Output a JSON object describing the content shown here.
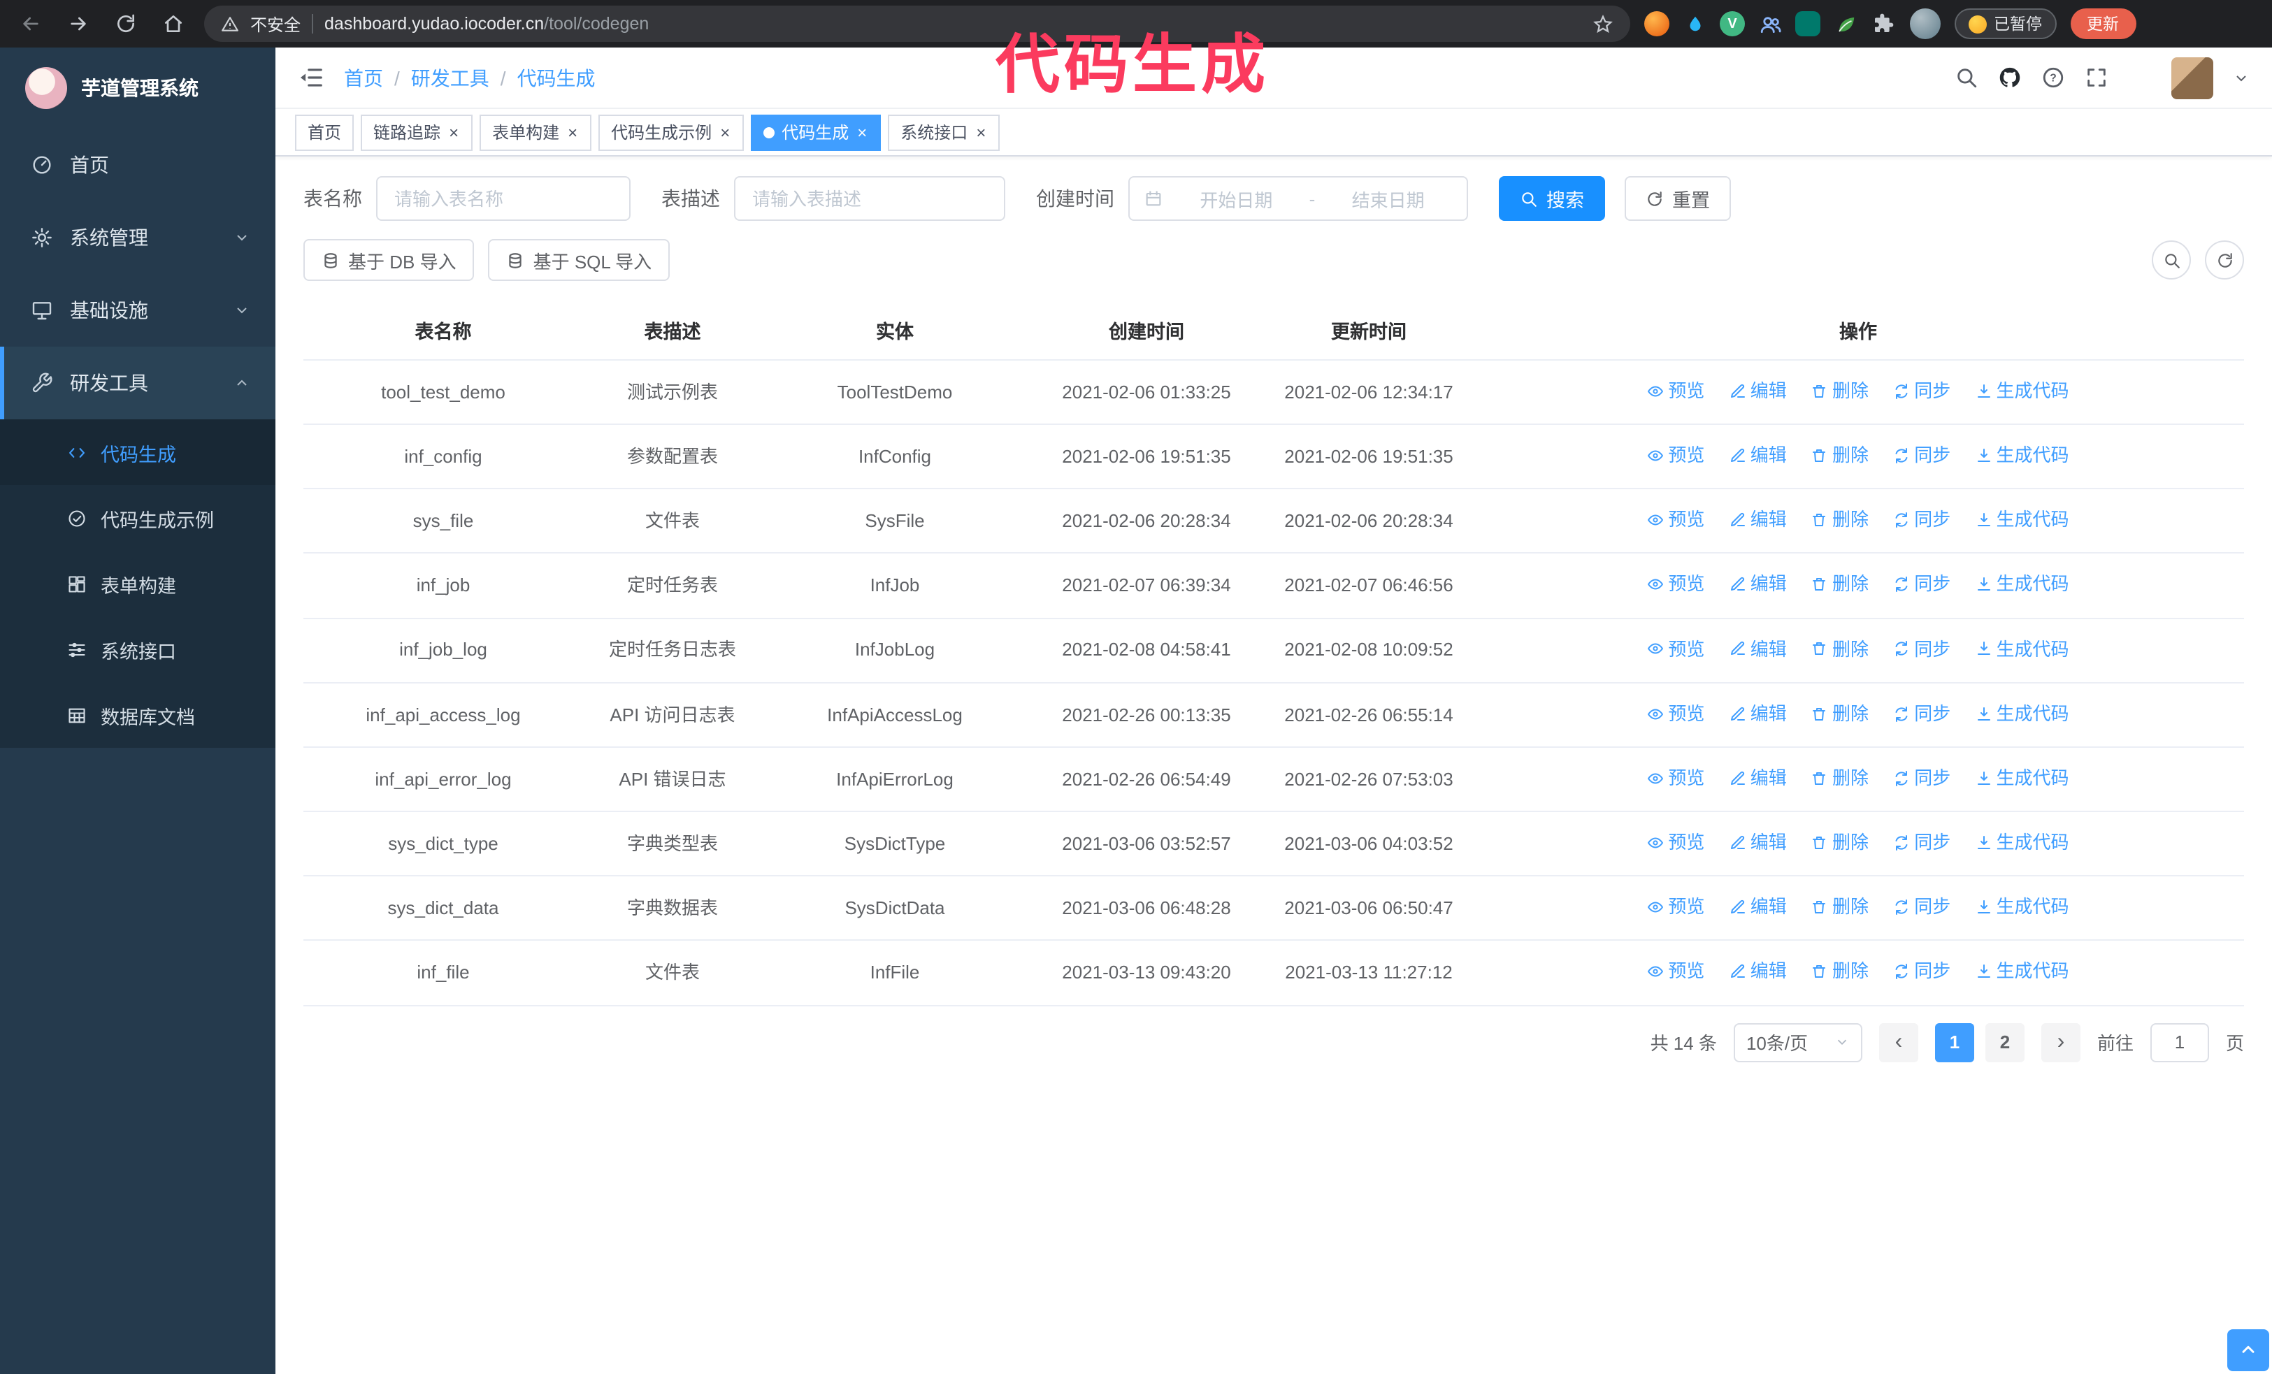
{
  "colors": {
    "accent": "#409EFF",
    "search_button": "#1890ff",
    "annotation": "#fb3b5e",
    "sidebar_bg": "#253a4d"
  },
  "annotation": {
    "text": "代码生成"
  },
  "browser": {
    "security": "不安全",
    "url": {
      "domain": "dashboard.yudao.iocoder.cn",
      "path": "/tool/codegen"
    },
    "paused_badge": "已暂停",
    "update_button": "更新"
  },
  "sidebar": {
    "title": "芋道管理系统",
    "items": [
      {
        "label": "首页",
        "icon": "gauge"
      },
      {
        "label": "系统管理",
        "icon": "gear",
        "chevron": "down"
      },
      {
        "label": "基础设施",
        "icon": "monitor",
        "chevron": "down"
      },
      {
        "label": "研发工具",
        "icon": "tools",
        "chevron": "up",
        "expanded": true,
        "children": [
          {
            "label": "代码生成",
            "icon": "code",
            "active": true
          },
          {
            "label": "代码生成示例",
            "icon": "check"
          },
          {
            "label": "表单构建",
            "icon": "form"
          },
          {
            "label": "系统接口",
            "icon": "api"
          },
          {
            "label": "数据库文档",
            "icon": "dbdoc"
          }
        ]
      }
    ]
  },
  "header": {
    "breadcrumb": [
      "首页",
      "研发工具",
      "代码生成"
    ],
    "separator": "/"
  },
  "tabs": [
    {
      "label": "首页",
      "closable": false,
      "active": false
    },
    {
      "label": "链路追踪",
      "closable": true,
      "active": false
    },
    {
      "label": "表单构建",
      "closable": true,
      "active": false
    },
    {
      "label": "代码生成示例",
      "closable": true,
      "active": false
    },
    {
      "label": "代码生成",
      "closable": true,
      "active": true
    },
    {
      "label": "系统接口",
      "closable": true,
      "active": false
    }
  ],
  "filters": {
    "name_label": "表名称",
    "name_placeholder": "请输入表名称",
    "desc_label": "表描述",
    "desc_placeholder": "请输入表描述",
    "time_label": "创建时间",
    "start_placeholder": "开始日期",
    "separator": "-",
    "end_placeholder": "结束日期",
    "search": "搜索",
    "reset": "重置"
  },
  "toolbar": {
    "import_db": "基于 DB 导入",
    "import_sql": "基于 SQL 导入"
  },
  "table": {
    "columns": [
      "表名称",
      "表描述",
      "实体",
      "创建时间",
      "更新时间",
      "操作"
    ],
    "actions": [
      {
        "label": "预览",
        "icon": "eye"
      },
      {
        "label": "编辑",
        "icon": "edit"
      },
      {
        "label": "删除",
        "icon": "trash"
      },
      {
        "label": "同步",
        "icon": "sync"
      },
      {
        "label": "生成代码",
        "icon": "download"
      }
    ],
    "rows": [
      {
        "name": "tool_test_demo",
        "desc": "测试示例表",
        "entity": "ToolTestDemo",
        "created": "2021-02-06 01:33:25",
        "updated": "2021-02-06 12:34:17"
      },
      {
        "name": "inf_config",
        "desc": "参数配置表",
        "entity": "InfConfig",
        "created": "2021-02-06 19:51:35",
        "updated": "2021-02-06 19:51:35"
      },
      {
        "name": "sys_file",
        "desc": "文件表",
        "entity": "SysFile",
        "created": "2021-02-06 20:28:34",
        "updated": "2021-02-06 20:28:34"
      },
      {
        "name": "inf_job",
        "desc": "定时任务表",
        "entity": "InfJob",
        "created": "2021-02-07 06:39:34",
        "updated": "2021-02-07 06:46:56"
      },
      {
        "name": "inf_job_log",
        "desc": "定时任务日志表",
        "entity": "InfJobLog",
        "created": "2021-02-08 04:58:41",
        "updated": "2021-02-08 10:09:52"
      },
      {
        "name": "inf_api_access_log",
        "desc": "API 访问日志表",
        "entity": "InfApiAccessLog",
        "created": "2021-02-26 00:13:35",
        "updated": "2021-02-26 06:55:14"
      },
      {
        "name": "inf_api_error_log",
        "desc": "API 错误日志",
        "entity": "InfApiErrorLog",
        "created": "2021-02-26 06:54:49",
        "updated": "2021-02-26 07:53:03"
      },
      {
        "name": "sys_dict_type",
        "desc": "字典类型表",
        "entity": "SysDictType",
        "created": "2021-03-06 03:52:57",
        "updated": "2021-03-06 04:03:52"
      },
      {
        "name": "sys_dict_data",
        "desc": "字典数据表",
        "entity": "SysDictData",
        "created": "2021-03-06 06:48:28",
        "updated": "2021-03-06 06:50:47"
      },
      {
        "name": "inf_file",
        "desc": "文件表",
        "entity": "InfFile",
        "created": "2021-03-13 09:43:20",
        "updated": "2021-03-13 11:27:12"
      }
    ]
  },
  "pagination": {
    "total": "共 14 条",
    "page_size": "10条/页",
    "pages": [
      "1",
      "2"
    ],
    "active_page": "1",
    "prev": "‹",
    "next": "›",
    "goto_label": "前往",
    "goto_value": "1",
    "goto_unit": "页"
  }
}
